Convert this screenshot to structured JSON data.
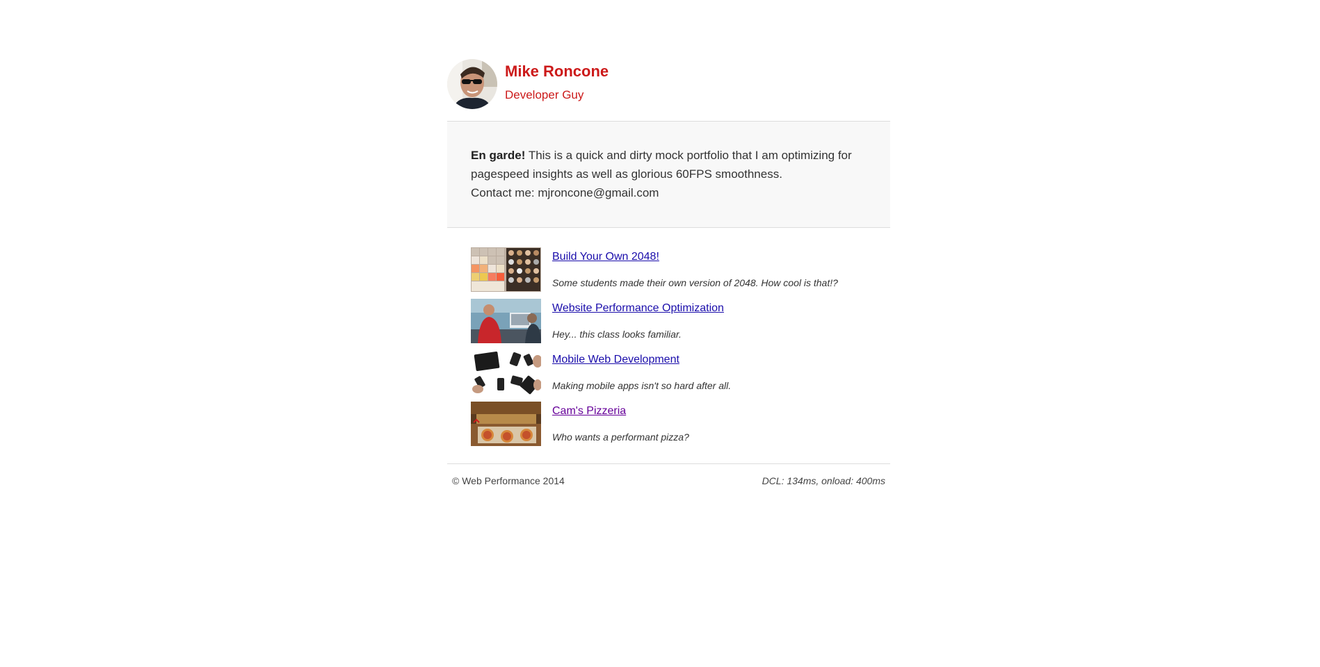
{
  "header": {
    "name": "Mike Roncone",
    "role": "Developer Guy",
    "avatar_icon": "profile-photo"
  },
  "intro": {
    "lead": "En garde!",
    "text": " This is a quick and dirty mock portfolio that I am optimizing for pagespeed insights as well as glorious 60FPS smoothness.",
    "contact": "Contact me: mjroncone@gmail.com"
  },
  "projects": [
    {
      "title": "Build Your Own 2048!",
      "description": "Some students made their own version of 2048. How cool is that!?",
      "thumb_icon": "2048-game-thumbnail"
    },
    {
      "title": "Website Performance Optimization",
      "description": "Hey... this class looks familiar.",
      "thumb_icon": "presenter-photo-thumbnail"
    },
    {
      "title": "Mobile Web Development",
      "description": "Making mobile apps isn't so hard after all.",
      "thumb_icon": "mobile-devices-thumbnail"
    },
    {
      "title": "Cam's Pizzeria",
      "description": "Who wants a performant pizza?",
      "thumb_icon": "pizzeria-thumbnail"
    }
  ],
  "footer": {
    "copyright": "© Web Performance 2014",
    "perf": "DCL: 134ms, onload: 400ms"
  },
  "colors": {
    "accent": "#cc1a1a",
    "link": "#1a0dab",
    "visited_link": "#660099",
    "intro_bg": "#f8f8f8",
    "divider": "#dddddd"
  }
}
